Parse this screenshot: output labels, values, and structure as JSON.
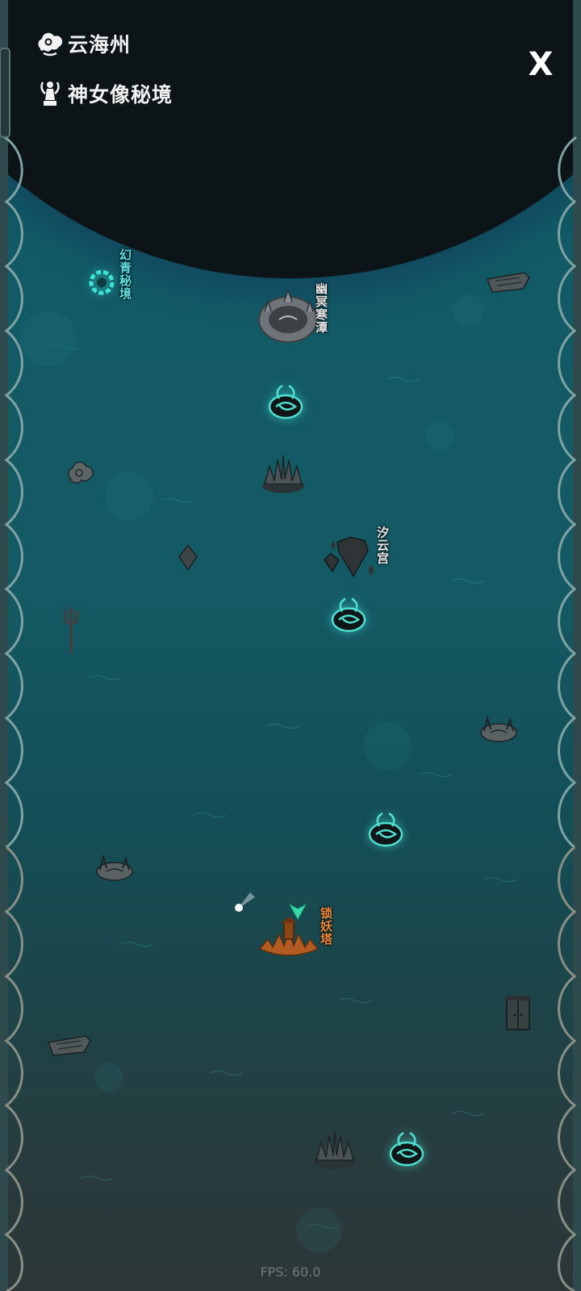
{
  "header": {
    "region_name": "云海州",
    "region_icon": "cloud-swirl-icon",
    "realm_name": "神女像秘境",
    "realm_icon": "goddess-statue-icon"
  },
  "close_button": {
    "label": "X",
    "icon": "close-icon"
  },
  "map": {
    "locations": [
      {
        "id": "huanqing",
        "label": "幻青秘境",
        "icon": "portal-ring-icon",
        "color": "#5fe0e0"
      },
      {
        "id": "youming",
        "label": "幽冥寒潭",
        "icon": "dark-pool-icon",
        "color": "#e8e8e8"
      },
      {
        "id": "xiyun",
        "label": "汐云宫",
        "icon": "floating-islands-icon",
        "color": "#e8e8e8"
      },
      {
        "id": "suoyao",
        "label": "锁妖塔",
        "icon": "pagoda-lotus-icon",
        "color": "#f08a3a"
      }
    ],
    "markers": [
      "whirlpool-icon",
      "whirlpool-icon",
      "whirlpool-icon",
      "whirlpool-icon",
      "spiky-lotus-icon",
      "spiky-lotus-icon",
      "shipwreck-icon",
      "shipwreck-icon",
      "ruins-icon",
      "ruins-icon",
      "cloud-swirl-icon",
      "rock-shard-icon",
      "trident-icon",
      "gate-icon",
      "player-arrow-icon",
      "light-orb-icon"
    ]
  },
  "fps_label": "FPS: 60.0",
  "colors": {
    "sea_top": "#0f5563",
    "sea_bottom": "#2c3637",
    "void": "#0c1418",
    "accent_cyan": "#5fe0e0",
    "accent_orange": "#f08a3a",
    "player_arrow": "#38d9a9"
  }
}
